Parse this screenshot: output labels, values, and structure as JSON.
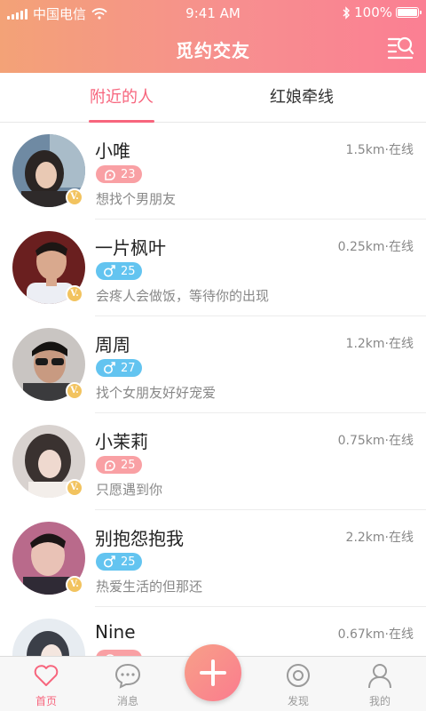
{
  "status_bar": {
    "carrier": "中国电信",
    "time": "9:41 AM",
    "battery": "100%"
  },
  "header": {
    "title": "觅约交友",
    "filter_icon": "filter-search-icon"
  },
  "tabs": [
    {
      "label": "附近的人",
      "active": true
    },
    {
      "label": "红娘牵线",
      "active": false
    }
  ],
  "colors": {
    "accent": "#f7657d",
    "female_badge": "#f9a0a4",
    "male_badge": "#63c4f0",
    "vip": "#f2c35f"
  },
  "users": [
    {
      "name": "小唯",
      "distance": "1.5km·在线",
      "gender": "female",
      "age": "23",
      "signature": "想找个男朋友",
      "vip": "V."
    },
    {
      "name": "一片枫叶",
      "distance": "0.25km·在线",
      "gender": "male",
      "age": "25",
      "signature": "会疼人会做饭，等待你的出现",
      "vip": "V."
    },
    {
      "name": "周周",
      "distance": "1.2km·在线",
      "gender": "male",
      "age": "27",
      "signature": "找个女朋友好好宠爱",
      "vip": "V."
    },
    {
      "name": "小茉莉",
      "distance": "0.75km·在线",
      "gender": "female",
      "age": "25",
      "signature": "只愿遇到你",
      "vip": "V."
    },
    {
      "name": "别抱怨抱我",
      "distance": "2.2km·在线",
      "gender": "male",
      "age": "25",
      "signature": "热爱生活的但那还",
      "vip": "V."
    },
    {
      "name": "Nine",
      "distance": "0.67km·在线",
      "gender": "female",
      "age": "",
      "signature": "",
      "vip": ""
    }
  ],
  "bottom_nav": [
    {
      "label": "首页",
      "icon": "heart-icon",
      "active": true
    },
    {
      "label": "消息",
      "icon": "chat-bubble-icon",
      "active": false
    },
    {
      "label": "",
      "icon": "plus-icon",
      "active": false
    },
    {
      "label": "发现",
      "icon": "discover-icon",
      "active": false
    },
    {
      "label": "我的",
      "icon": "person-icon",
      "active": false
    }
  ]
}
